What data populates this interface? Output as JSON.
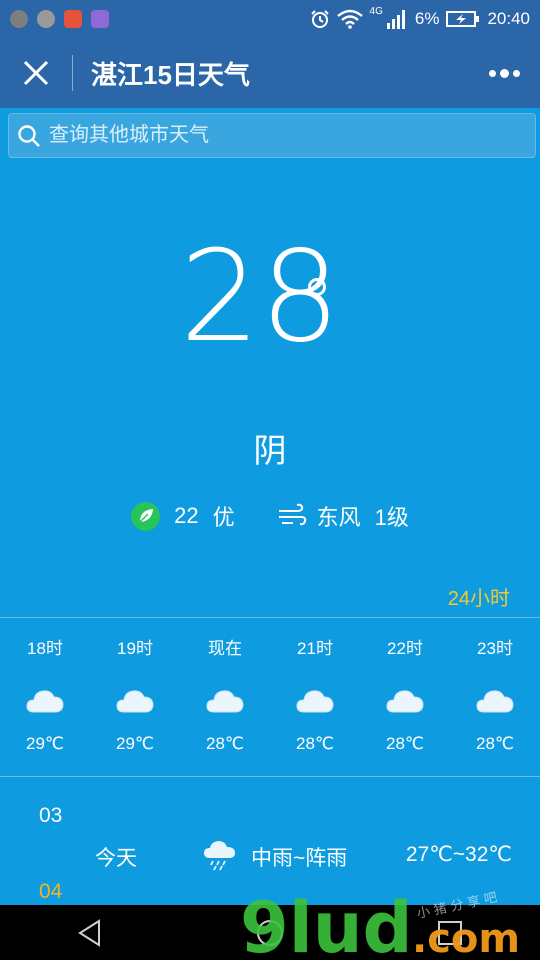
{
  "status_bar": {
    "battery_percent": "6%",
    "time": "20:40",
    "network": "4G",
    "notification_colors": [
      "#7e7e7e",
      "#9a9a9a",
      "#e5533d",
      "#8e6ad8"
    ]
  },
  "title_bar": {
    "title": "湛江15日天气",
    "close_icon": "close-icon",
    "more_icon": "more-dots-icon"
  },
  "search": {
    "placeholder": "查询其他城市天气",
    "icon": "search-icon"
  },
  "current": {
    "temperature": "28",
    "condition": "阴",
    "aqi_value": "22",
    "aqi_level": "优",
    "wind_direction": "东风",
    "wind_level": "1级"
  },
  "hourly": {
    "link_label": "24小时",
    "link_color": "#f3c930",
    "items": [
      {
        "label": "18时",
        "temp": "29℃",
        "icon": "cloud-icon"
      },
      {
        "label": "19时",
        "temp": "29℃",
        "icon": "cloud-icon"
      },
      {
        "label": "现在",
        "temp": "28℃",
        "icon": "cloud-icon"
      },
      {
        "label": "21时",
        "temp": "28℃",
        "icon": "cloud-icon"
      },
      {
        "label": "22时",
        "temp": "28℃",
        "icon": "cloud-icon"
      },
      {
        "label": "23时",
        "temp": "28℃",
        "icon": "cloud-icon"
      }
    ]
  },
  "daily": {
    "date_first": "03",
    "today": {
      "name": "今天",
      "condition": "中雨~阵雨",
      "range": "27℃~32℃",
      "icon": "rain-cloud-icon"
    },
    "date_second": "04"
  },
  "watermark": {
    "brand": "9lud",
    "domain": ".com",
    "tagline": "小 猪 分 享 吧"
  },
  "colors": {
    "header": "#2a66a8",
    "background": "#0f9be0",
    "aqi_badge": "#27c35b",
    "watermark_green": "#3cc23c",
    "watermark_orange": "#f29a1a"
  }
}
